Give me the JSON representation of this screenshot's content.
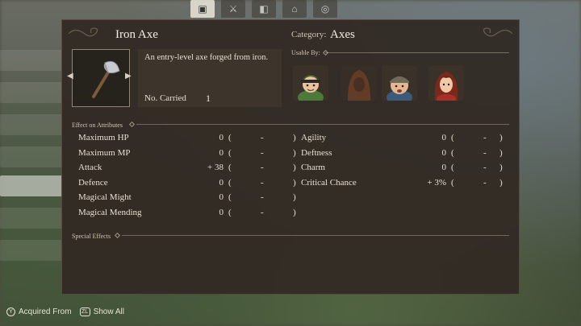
{
  "item": {
    "name": "Iron Axe",
    "category_label": "Category:",
    "category_value": "Axes",
    "description": "An entry-level axe forged from iron.",
    "carried_label": "No. Carried",
    "carried_value": "1",
    "icon": "axe-icon"
  },
  "usable": {
    "label": "Usable By:",
    "characters": [
      {
        "name": "hero-green-hat",
        "usable": true
      },
      {
        "name": "hooded-character",
        "usable": false
      },
      {
        "name": "bandana-character",
        "usable": true
      },
      {
        "name": "red-hair-character",
        "usable": true
      }
    ]
  },
  "attributes": {
    "label": "Effect on Attributes",
    "left": [
      {
        "name": "Maximum HP",
        "value": "0",
        "delta": "-"
      },
      {
        "name": "Maximum MP",
        "value": "0",
        "delta": "-"
      },
      {
        "name": "Attack",
        "value": "+ 38",
        "delta": "-"
      },
      {
        "name": "Defence",
        "value": "0",
        "delta": "-"
      },
      {
        "name": "Magical Might",
        "value": "0",
        "delta": "-"
      },
      {
        "name": "Magical Mending",
        "value": "0",
        "delta": "-"
      }
    ],
    "right": [
      {
        "name": "Agility",
        "value": "0",
        "delta": "-"
      },
      {
        "name": "Deftness",
        "value": "0",
        "delta": "-"
      },
      {
        "name": "Charm",
        "value": "0",
        "delta": "-"
      },
      {
        "name": "Critical Chance",
        "value": "+ 3%",
        "delta": "-"
      }
    ]
  },
  "special": {
    "label": "Special Effects"
  },
  "footer": {
    "acquired_button": "Y",
    "acquired_label": "Acquired From",
    "show_all_button": "ZL",
    "show_all_label": "Show All"
  }
}
